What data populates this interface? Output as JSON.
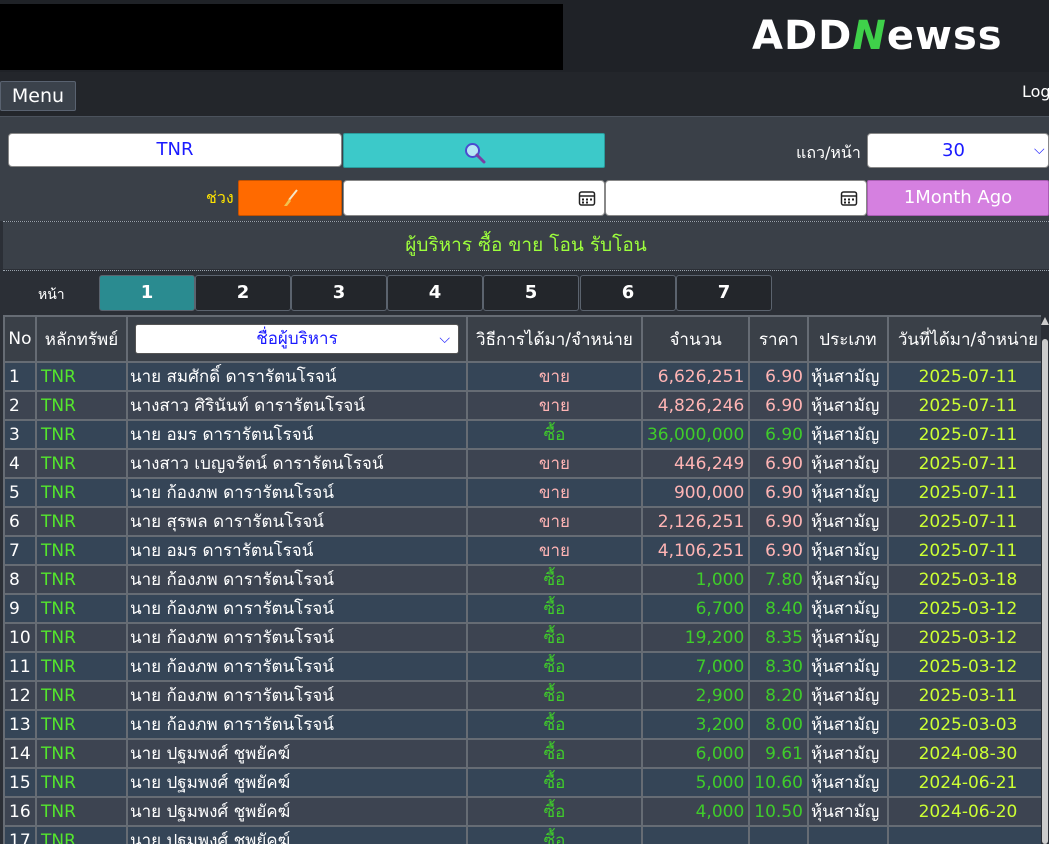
{
  "header": {
    "logo_text_1": "ADD",
    "logo_text_n": "N",
    "logo_text_2": "ewss",
    "menu_label": "Menu",
    "login_label": "Log"
  },
  "filters": {
    "symbol_value": "TNR",
    "search_icon": "search-icon",
    "rows_label": "แถว/หน้า",
    "rows_value": "30",
    "range_label": "ช่วง",
    "clear_icon": "broom-icon",
    "date_from": "",
    "date_to": "",
    "month_button": "1Month Ago"
  },
  "title": "ผู้บริหาร ซื้อ ขาย โอน รับโอน",
  "pagination": {
    "label": "หน้า",
    "pages": [
      "1",
      "2",
      "3",
      "4",
      "5",
      "6",
      "7"
    ],
    "active": "1"
  },
  "table": {
    "headers": {
      "no": "No",
      "symbol": "หลักทรัพย์",
      "executive": "ชื่อผู้บริหาร",
      "method": "วิธีการได้มา/จำหน่าย",
      "amount": "จำนวน",
      "price": "ราคา",
      "class": "ประเภท",
      "date": "วันที่ได้มา/จำหน่าย"
    },
    "rows": [
      {
        "no": "1",
        "symbol": "TNR",
        "name": "นาย สมศักดิ์ ดารารัตนโรจน์",
        "type": "ขาย",
        "amount": "6,626,251",
        "price": "6.90",
        "cls": "หุ้นสามัญ",
        "date": "2025-07-11",
        "kind": "sell"
      },
      {
        "no": "2",
        "symbol": "TNR",
        "name": "นางสาว ศิรินันท์ ดารารัตนโรจน์",
        "type": "ขาย",
        "amount": "4,826,246",
        "price": "6.90",
        "cls": "หุ้นสามัญ",
        "date": "2025-07-11",
        "kind": "sell"
      },
      {
        "no": "3",
        "symbol": "TNR",
        "name": "นาย อมร ดารารัตนโรจน์",
        "type": "ซื้อ",
        "amount": "36,000,000",
        "price": "6.90",
        "cls": "หุ้นสามัญ",
        "date": "2025-07-11",
        "kind": "buy"
      },
      {
        "no": "4",
        "symbol": "TNR",
        "name": "นางสาว เบญจรัตน์ ดารารัตนโรจน์",
        "type": "ขาย",
        "amount": "446,249",
        "price": "6.90",
        "cls": "หุ้นสามัญ",
        "date": "2025-07-11",
        "kind": "sell"
      },
      {
        "no": "5",
        "symbol": "TNR",
        "name": "นาย ก้องภพ ดารารัตนโรจน์",
        "type": "ขาย",
        "amount": "900,000",
        "price": "6.90",
        "cls": "หุ้นสามัญ",
        "date": "2025-07-11",
        "kind": "sell"
      },
      {
        "no": "6",
        "symbol": "TNR",
        "name": "นาย สุรพล ดารารัตนโรจน์",
        "type": "ขาย",
        "amount": "2,126,251",
        "price": "6.90",
        "cls": "หุ้นสามัญ",
        "date": "2025-07-11",
        "kind": "sell"
      },
      {
        "no": "7",
        "symbol": "TNR",
        "name": "นาย อมร ดารารัตนโรจน์",
        "type": "ขาย",
        "amount": "4,106,251",
        "price": "6.90",
        "cls": "หุ้นสามัญ",
        "date": "2025-07-11",
        "kind": "sell"
      },
      {
        "no": "8",
        "symbol": "TNR",
        "name": "นาย ก้องภพ ดารารัตนโรจน์",
        "type": "ซื้อ",
        "amount": "1,000",
        "price": "7.80",
        "cls": "หุ้นสามัญ",
        "date": "2025-03-18",
        "kind": "buy"
      },
      {
        "no": "9",
        "symbol": "TNR",
        "name": "นาย ก้องภพ ดารารัตนโรจน์",
        "type": "ซื้อ",
        "amount": "6,700",
        "price": "8.40",
        "cls": "หุ้นสามัญ",
        "date": "2025-03-12",
        "kind": "buy"
      },
      {
        "no": "10",
        "symbol": "TNR",
        "name": "นาย ก้องภพ ดารารัตนโรจน์",
        "type": "ซื้อ",
        "amount": "19,200",
        "price": "8.35",
        "cls": "หุ้นสามัญ",
        "date": "2025-03-12",
        "kind": "buy"
      },
      {
        "no": "11",
        "symbol": "TNR",
        "name": "นาย ก้องภพ ดารารัตนโรจน์",
        "type": "ซื้อ",
        "amount": "7,000",
        "price": "8.30",
        "cls": "หุ้นสามัญ",
        "date": "2025-03-12",
        "kind": "buy"
      },
      {
        "no": "12",
        "symbol": "TNR",
        "name": "นาย ก้องภพ ดารารัตนโรจน์",
        "type": "ซื้อ",
        "amount": "2,900",
        "price": "8.20",
        "cls": "หุ้นสามัญ",
        "date": "2025-03-11",
        "kind": "buy"
      },
      {
        "no": "13",
        "symbol": "TNR",
        "name": "นาย ก้องภพ ดารารัตนโรจน์",
        "type": "ซื้อ",
        "amount": "3,200",
        "price": "8.00",
        "cls": "หุ้นสามัญ",
        "date": "2025-03-03",
        "kind": "buy"
      },
      {
        "no": "14",
        "symbol": "TNR",
        "name": "นาย ปฐมพงศ์ ชูพยัคฆ์",
        "type": "ซื้อ",
        "amount": "6,000",
        "price": "9.61",
        "cls": "หุ้นสามัญ",
        "date": "2024-08-30",
        "kind": "buy"
      },
      {
        "no": "15",
        "symbol": "TNR",
        "name": "นาย ปฐมพงศ์ ชูพยัคฆ์",
        "type": "ซื้อ",
        "amount": "5,000",
        "price": "10.60",
        "cls": "หุ้นสามัญ",
        "date": "2024-06-21",
        "kind": "buy"
      },
      {
        "no": "16",
        "symbol": "TNR",
        "name": "นาย ปฐมพงศ์ ชูพยัคฆ์",
        "type": "ซื้อ",
        "amount": "4,000",
        "price": "10.50",
        "cls": "หุ้นสามัญ",
        "date": "2024-06-20",
        "kind": "buy"
      },
      {
        "no": "17",
        "symbol": "TNR",
        "name": "นาย ปฐมพงศ์ ชูพยัคฆ์",
        "type": "ซื้อ",
        "amount": "",
        "price": "",
        "cls": "",
        "date": "",
        "kind": "buy"
      }
    ]
  }
}
